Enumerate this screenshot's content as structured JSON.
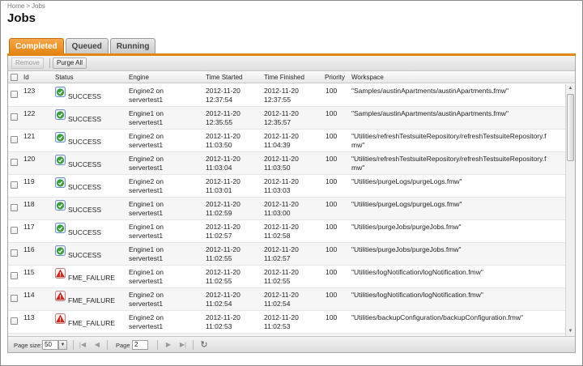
{
  "breadcrumb": {
    "home": "Home",
    "separator": ">",
    "current": "Jobs"
  },
  "page_title": "Jobs",
  "tabs": [
    {
      "label": "Completed",
      "active": true
    },
    {
      "label": "Queued",
      "active": false
    },
    {
      "label": "Running",
      "active": false
    }
  ],
  "toolbar": {
    "remove_label": "Remove",
    "purge_label": "Purge All"
  },
  "columns": {
    "id": "Id",
    "status": "Status",
    "engine": "Engine",
    "started": "Time Started",
    "finished": "Time Finished",
    "priority": "Priority",
    "workspace": "Workspace"
  },
  "colors": {
    "accent": "#e38512",
    "success": "#3aa33a",
    "failure": "#d62b1e"
  },
  "icons": {
    "success": "success-check-icon",
    "failure": "failure-warning-icon"
  },
  "rows": [
    {
      "id": "123",
      "status": "SUCCESS",
      "engine": [
        "Engine2 on",
        "servertest1"
      ],
      "started": [
        "2012-11-20",
        "12:37:54"
      ],
      "finished": [
        "2012-11-20",
        "12:37:55"
      ],
      "priority": "100",
      "workspace": [
        "\"Samples/austinApartments/austinApartments.fmw\""
      ]
    },
    {
      "id": "122",
      "status": "SUCCESS",
      "engine": [
        "Engine1 on",
        "servertest1"
      ],
      "started": [
        "2012-11-20",
        "12:35:55"
      ],
      "finished": [
        "2012-11-20",
        "12:35:57"
      ],
      "priority": "100",
      "workspace": [
        "\"Samples/austinApartments/austinApartments.fmw\""
      ]
    },
    {
      "id": "121",
      "status": "SUCCESS",
      "engine": [
        "Engine2 on",
        "servertest1"
      ],
      "started": [
        "2012-11-20",
        "11:03:50"
      ],
      "finished": [
        "2012-11-20",
        "11:04:39"
      ],
      "priority": "100",
      "workspace": [
        "\"Utilities/refreshTestsuiteRepository/refreshTestsuiteRepository.f",
        "mw\""
      ]
    },
    {
      "id": "120",
      "status": "SUCCESS",
      "engine": [
        "Engine2 on",
        "servertest1"
      ],
      "started": [
        "2012-11-20",
        "11:03:04"
      ],
      "finished": [
        "2012-11-20",
        "11:03:50"
      ],
      "priority": "100",
      "workspace": [
        "\"Utilities/refreshTestsuiteRepository/refreshTestsuiteRepository.f",
        "mw\""
      ]
    },
    {
      "id": "119",
      "status": "SUCCESS",
      "engine": [
        "Engine2 on",
        "servertest1"
      ],
      "started": [
        "2012-11-20",
        "11:03:01"
      ],
      "finished": [
        "2012-11-20",
        "11:03:03"
      ],
      "priority": "100",
      "workspace": [
        "\"Utilities/purgeLogs/purgeLogs.fmw\""
      ]
    },
    {
      "id": "118",
      "status": "SUCCESS",
      "engine": [
        "Engine1 on",
        "servertest1"
      ],
      "started": [
        "2012-11-20",
        "11:02:59"
      ],
      "finished": [
        "2012-11-20",
        "11:03:00"
      ],
      "priority": "100",
      "workspace": [
        "\"Utilities/purgeLogs/purgeLogs.fmw\""
      ]
    },
    {
      "id": "117",
      "status": "SUCCESS",
      "engine": [
        "Engine1 on",
        "servertest1"
      ],
      "started": [
        "2012-11-20",
        "11:02:57"
      ],
      "finished": [
        "2012-11-20",
        "11:02:58"
      ],
      "priority": "100",
      "workspace": [
        "\"Utilities/purgeJobs/purgeJobs.fmw\""
      ]
    },
    {
      "id": "116",
      "status": "SUCCESS",
      "engine": [
        "Engine1 on",
        "servertest1"
      ],
      "started": [
        "2012-11-20",
        "11:02:55"
      ],
      "finished": [
        "2012-11-20",
        "11:02:57"
      ],
      "priority": "100",
      "workspace": [
        "\"Utilities/purgeJobs/purgeJobs.fmw\""
      ]
    },
    {
      "id": "115",
      "status": "FME_FAILURE",
      "engine": [
        "Engine1 on",
        "servertest1"
      ],
      "started": [
        "2012-11-20",
        "11:02:55"
      ],
      "finished": [
        "2012-11-20",
        "11:02:55"
      ],
      "priority": "100",
      "workspace": [
        "\"Utilities/logNotification/logNotification.fmw\""
      ]
    },
    {
      "id": "114",
      "status": "FME_FAILURE",
      "engine": [
        "Engine2 on",
        "servertest1"
      ],
      "started": [
        "2012-11-20",
        "11:02:54"
      ],
      "finished": [
        "2012-11-20",
        "11:02:54"
      ],
      "priority": "100",
      "workspace": [
        "\"Utilities/logNotification/logNotification.fmw\""
      ]
    },
    {
      "id": "113",
      "status": "FME_FAILURE",
      "engine": [
        "Engine2 on",
        "servertest1"
      ],
      "started": [
        "2012-11-20",
        "11:02:53"
      ],
      "finished": [
        "2012-11-20",
        "11:02:53"
      ],
      "priority": "100",
      "workspace": [
        "\"Utilities/backupConfiguration/backupConfiguration.fmw\""
      ]
    }
  ],
  "pager": {
    "page_size_label": "Page size:",
    "page_size": "50",
    "page_label": "Page",
    "page": "2"
  }
}
